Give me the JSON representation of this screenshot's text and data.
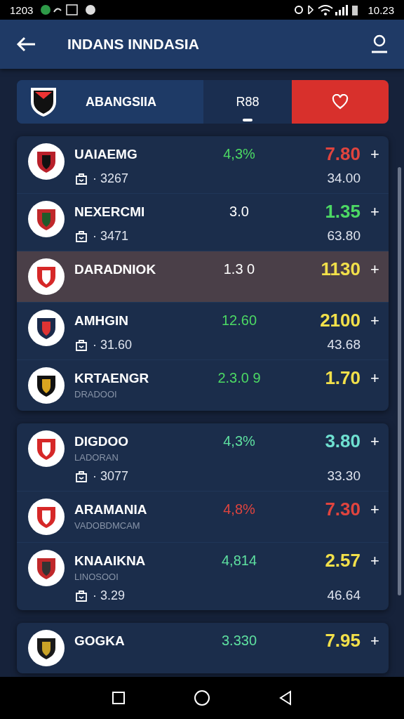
{
  "status_bar": {
    "time": "1203",
    "right_text": "10.23"
  },
  "header": {
    "title": "INDANS INNDASIA"
  },
  "tabs": [
    {
      "kind": "team",
      "label": "ABANGSIIA",
      "selected": false
    },
    {
      "kind": "label",
      "label": "R88",
      "selected": true
    },
    {
      "kind": "favorite",
      "selected": false
    }
  ],
  "groups": [
    {
      "rows": [
        {
          "name": "UAIAEMG",
          "stat": "· 3267",
          "change": {
            "text": "4,3%",
            "color": "#4cd964"
          },
          "odds": {
            "text": "7.80",
            "color": "#e0443e"
          },
          "add": "+",
          "total": "34.00",
          "highlighted": false
        },
        {
          "name": "NEXERCMI",
          "stat": "· 3471",
          "change": {
            "text": "3.0",
            "color": "#ffffff"
          },
          "odds": {
            "text": "1.35",
            "color": "#4cd964"
          },
          "add": "+",
          "total": "63.80",
          "highlighted": false
        },
        {
          "name": "DARADNIOK",
          "change": {
            "text": "1.3 0",
            "color": "#ffffff"
          },
          "odds": {
            "text": "1130",
            "color": "#f2e04a"
          },
          "add": "+",
          "highlighted": true
        },
        {
          "name": "AMHGIN",
          "stat": "· 31.60",
          "change": {
            "text": "12.60",
            "color": "#4cd964"
          },
          "odds": {
            "text": "2100",
            "color": "#f2e04a"
          },
          "add": "+",
          "total": "43.68",
          "highlighted": false
        },
        {
          "name": "KRTAENGR",
          "subtitle": "DRADOOI",
          "change": {
            "text": "2.3.0 9",
            "color": "#4cd964"
          },
          "odds": {
            "text": "1.70",
            "color": "#f2e04a"
          },
          "add": "+",
          "highlighted": false
        }
      ]
    },
    {
      "rows": [
        {
          "name": "DIGDOO",
          "subtitle": "LADORAN",
          "stat": "· 3077",
          "change": {
            "text": "4,3%",
            "color": "#5ee0a0"
          },
          "odds": {
            "text": "3.80",
            "color": "#6fe0d0"
          },
          "add": "+",
          "total": "33.30",
          "highlighted": false
        },
        {
          "name": "ARAMANIA",
          "subtitle": "VADOBDMCAM",
          "change": {
            "text": "4,8%",
            "color": "#e0443e"
          },
          "odds": {
            "text": "7.30",
            "color": "#e0443e"
          },
          "add": "+",
          "highlighted": false
        },
        {
          "name": "KNAAIKNA",
          "subtitle": "LINOSOOI",
          "stat": "· 3.29",
          "change": {
            "text": "4,814",
            "color": "#5ee0a0"
          },
          "odds": {
            "text": "2.57",
            "color": "#f2e04a"
          },
          "add": "+",
          "total": "46.64",
          "highlighted": false
        }
      ]
    },
    {
      "rows": [
        {
          "name": "GOGKA",
          "change": {
            "text": "3.330",
            "color": "#5ee0a0"
          },
          "odds": {
            "text": "7.95",
            "color": "#f2e04a"
          },
          "add": "+",
          "highlighted": false
        }
      ]
    }
  ]
}
